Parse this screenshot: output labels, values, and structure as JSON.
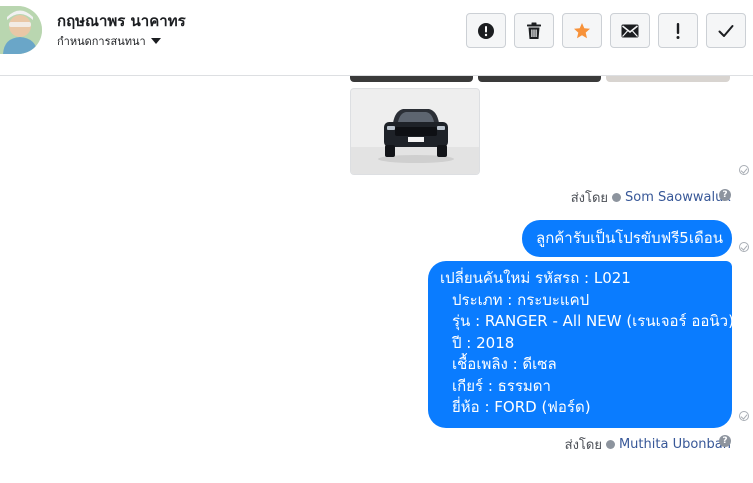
{
  "header": {
    "contact_name": "กฤษณาพร นาคาทร",
    "conversation_setting": "กำหนดการสนทนา"
  },
  "toolbar": {
    "buttons": [
      {
        "name": "report-spam-button",
        "icon": "exclamation-circle-icon"
      },
      {
        "name": "delete-button",
        "icon": "trash-icon"
      },
      {
        "name": "star-button",
        "icon": "star-icon"
      },
      {
        "name": "mark-unread-button",
        "icon": "envelope-icon"
      },
      {
        "name": "follow-up-button",
        "icon": "exclamation-icon"
      },
      {
        "name": "mark-done-button",
        "icon": "checkmark-icon"
      }
    ],
    "star_color": "#f7923a"
  },
  "messages": {
    "first_sent_by_label": "ส่งโดย",
    "first_sender": "Som Saowwalux",
    "short_message": "ลูกค้ารับเป็นโปรขับฟรี5เดือน",
    "long_message_lines": [
      "เปลี่ยนคันใหม่ รหัสรถ : L021",
      "ประเภท : กระบะแคป",
      "รุ่น : RANGER - All NEW (เรนเจอร์ ออนิว)",
      "ปี : 2018",
      "เชื้อเพลิง : ดีเซล",
      "เกียร์ : ธรรมดา",
      "ยี่ห้อ : FORD (ฟอร์ด)"
    ],
    "second_sent_by_label": "ส่งโดย",
    "second_sender": "Muthita Ubonban",
    "bubble_color": "#0a7cff"
  }
}
